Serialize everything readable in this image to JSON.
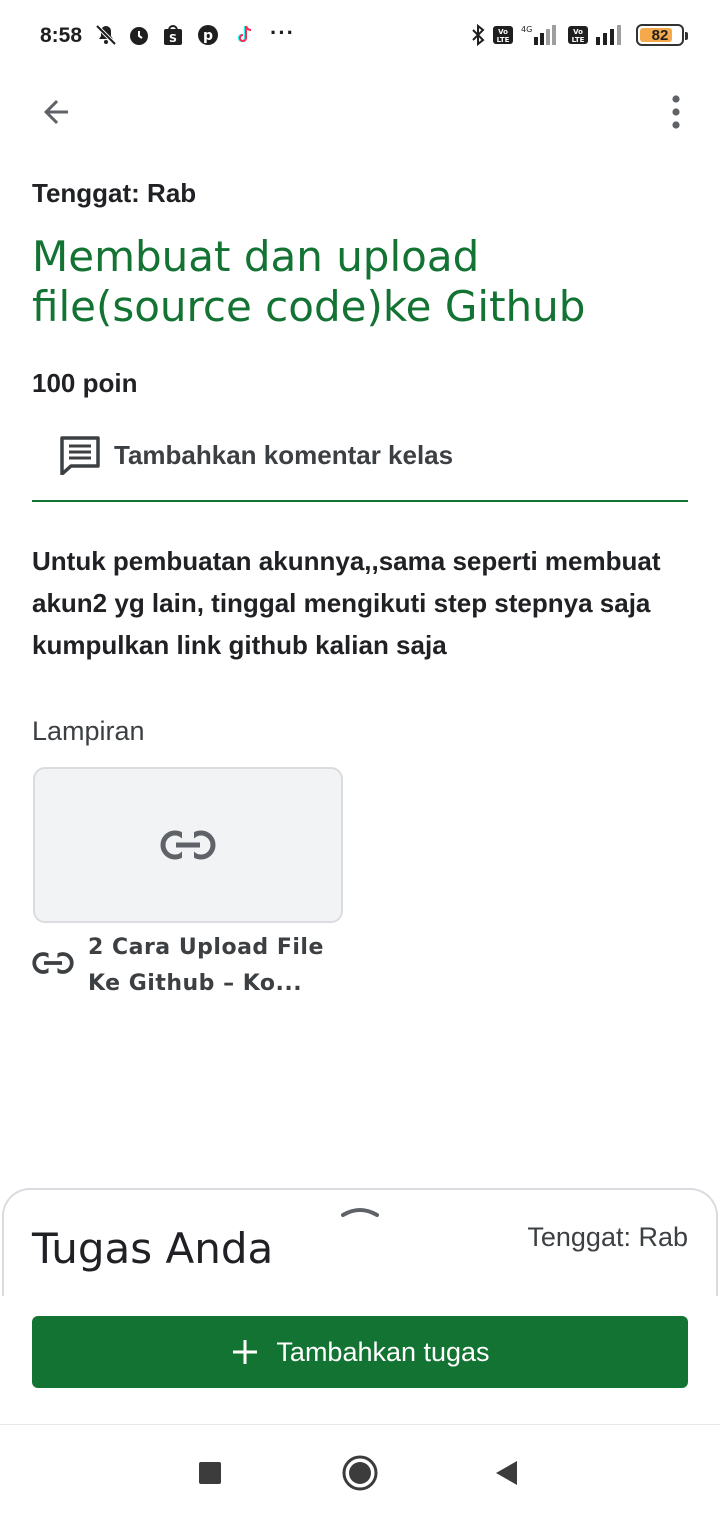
{
  "status_bar": {
    "time": "8:58",
    "icons": [
      "mute-icon",
      "alarm-icon",
      "shopee-icon",
      "pinterest-icon",
      "tiktok-icon",
      "more-notifications-icon",
      "bluetooth-icon",
      "volte-icon",
      "signal-4g-icon",
      "volte-icon",
      "signal-icon"
    ],
    "more": "···",
    "battery_level": "82",
    "battery_color": "#f6a94a"
  },
  "app_bar": {
    "back_icon": "arrow-back-icon",
    "menu_icon": "more-vert-icon"
  },
  "assignment": {
    "due": "Tenggat: Rab",
    "title": "Membuat dan upload file(source code)ke Github",
    "points": "100 poin",
    "comment_label": "Tambahkan komentar kelas",
    "description": "Untuk pembuatan akunnya,,sama seperti membuat akun2 yg lain, tinggal mengikuti step stepnya saja kumpulkan link github kalian saja"
  },
  "attachments": {
    "label": "Lampiran",
    "items": [
      {
        "title": "2 Cara Upload File Ke Github – Ko...",
        "icon": "link-icon"
      }
    ]
  },
  "bottom_sheet": {
    "title": "Tugas Anda",
    "due": "Tenggat: Rab",
    "add_button_label": "Tambahkan tugas"
  },
  "colors": {
    "accent": "#137333",
    "title_green": "#137333"
  },
  "nav_bar": {
    "buttons": [
      "recents-icon",
      "home-icon",
      "back-icon"
    ]
  }
}
